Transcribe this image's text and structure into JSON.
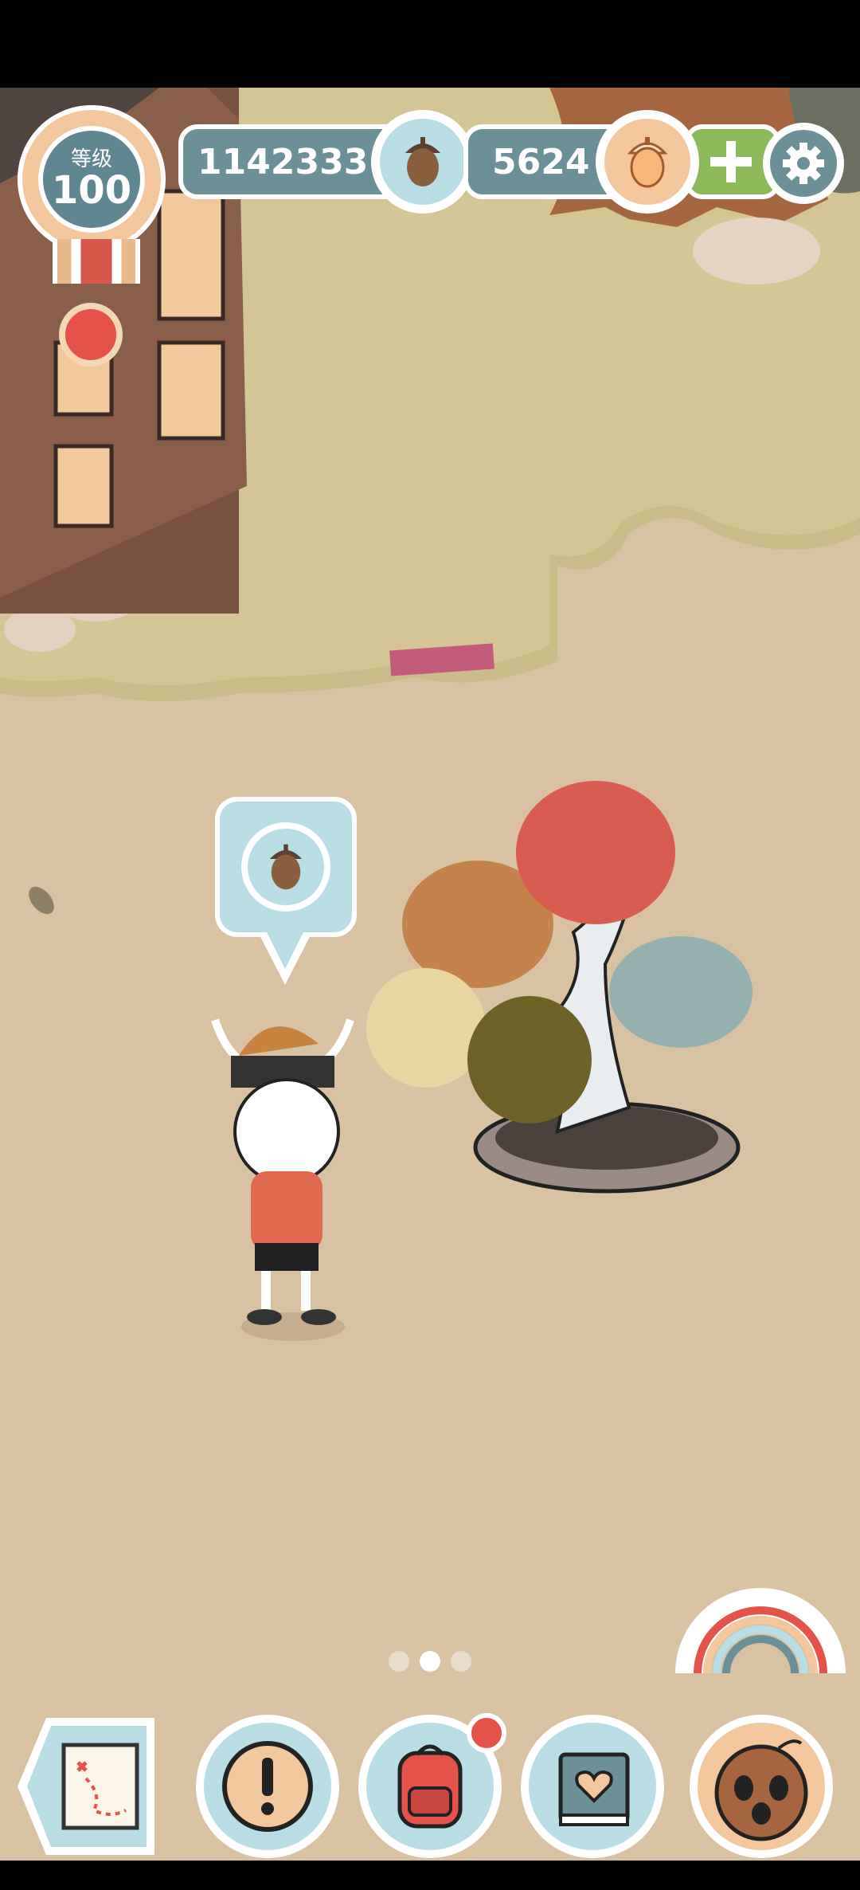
{
  "hud": {
    "level_label": "等级",
    "level_value": "100",
    "acorn_count": "1142333",
    "golden_acorn_count": "5624"
  },
  "icons": {
    "acorn": "acorn-icon",
    "golden_acorn": "golden-acorn-icon",
    "plus": "plus-icon",
    "settings": "gear-icon",
    "map": "map-icon",
    "alert": "exclamation-icon",
    "backpack": "backpack-icon",
    "book": "heart-book-icon",
    "friend": "coconut-face-icon",
    "rainbow": "rainbow-icon"
  },
  "pager": {
    "pages": 3,
    "active": 2
  },
  "colors": {
    "hud_panel": "#6c9098",
    "badge_orange": "#f3c79b",
    "plus_green": "#8cba59",
    "alert_red": "#e5524a",
    "ground": "#d8c2a1",
    "grass": "#cdbf8d"
  }
}
